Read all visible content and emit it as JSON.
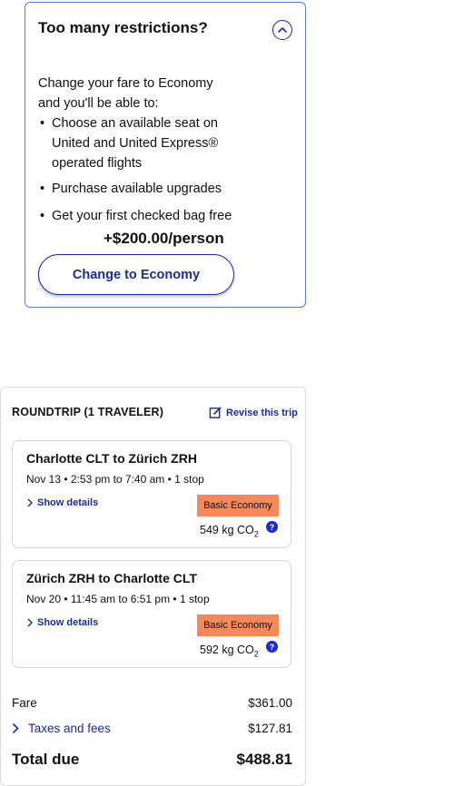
{
  "upsell": {
    "title": "Too many restrictions?",
    "intro": "Change your fare to Economy and you'll be able to:",
    "benefits": [
      "Choose an available seat on United and United Express® operated flights",
      "Purchase available upgrades",
      "Get your first checked bag free"
    ],
    "price": "+$200.00/person",
    "button_label": "Change to Economy",
    "toggle_icon": "chevron-up-circle-icon"
  },
  "summary": {
    "heading": "ROUNDTRIP (1 TRAVELER)",
    "revise_label": "Revise this trip",
    "revise_icon": "edit-icon",
    "flights": [
      {
        "route": "Charlotte CLT to Zürich ZRH",
        "schedule": "Nov 13 • 2:53 pm to 7:40 am • 1 stop",
        "details_label": "Show details",
        "fare_class": "Basic Economy",
        "co2_value": "549 kg CO",
        "co2_sub": "2",
        "help_label": "?"
      },
      {
        "route": "Zürich ZRH to Charlotte CLT",
        "schedule": "Nov 20 • 11:45 am to 6:51 pm • 1 stop",
        "details_label": "Show details",
        "fare_class": "Basic Economy",
        "co2_value": "592 kg CO",
        "co2_sub": "2",
        "help_label": "?"
      }
    ],
    "fare_label": "Fare",
    "fare_value": "$361.00",
    "taxes_label": "Taxes and fees",
    "taxes_value": "$127.81",
    "total_label": "Total due",
    "total_value": "$488.81"
  },
  "colors": {
    "brand_blue": "#1b2aa0",
    "badge_orange": "#f6885a",
    "card_border": "#5b7fd6"
  }
}
